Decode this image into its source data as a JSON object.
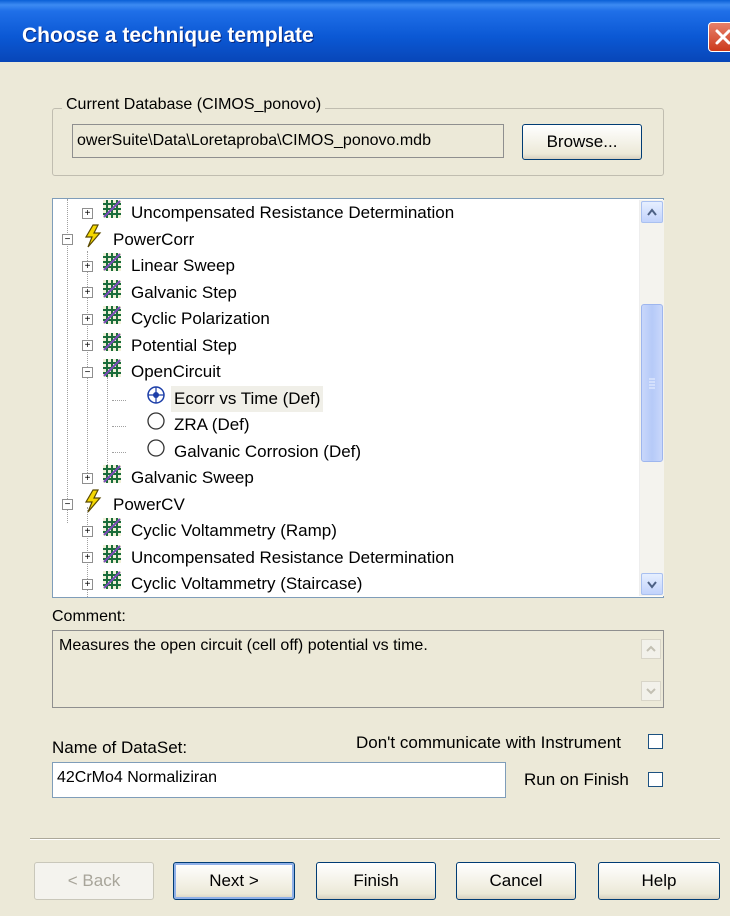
{
  "window": {
    "title": "Choose a technique template"
  },
  "database": {
    "group_label": "Current Database (CIMOS_ponovo)",
    "path": "owerSuite\\Data\\Loretaproba\\CIMOS_ponovo.mdb",
    "browse_label": "Browse..."
  },
  "tree": {
    "items": [
      {
        "label": "Uncompensated Resistance Determination",
        "icon": "grid-icon",
        "expander": "+"
      },
      {
        "label": "PowerCorr",
        "icon": "lightning-icon",
        "expander": "-"
      },
      {
        "label": "Linear Sweep",
        "icon": "grid-icon",
        "expander": "+"
      },
      {
        "label": "Galvanic Step",
        "icon": "grid-icon",
        "expander": "+"
      },
      {
        "label": "Cyclic Polarization",
        "icon": "grid-icon",
        "expander": "+"
      },
      {
        "label": "Potential Step",
        "icon": "grid-icon",
        "expander": "+"
      },
      {
        "label": "OpenCircuit",
        "icon": "grid-icon",
        "expander": "-"
      },
      {
        "label": "Ecorr vs Time (Def)",
        "icon": "radio-selected-icon",
        "selected": true
      },
      {
        "label": "ZRA (Def)",
        "icon": "radio-icon"
      },
      {
        "label": "Galvanic Corrosion (Def)",
        "icon": "radio-icon"
      },
      {
        "label": "Galvanic Sweep",
        "icon": "grid-icon",
        "expander": "+"
      },
      {
        "label": "PowerCV",
        "icon": "lightning-icon",
        "expander": "-"
      },
      {
        "label": "Cyclic Voltammetry (Ramp)",
        "icon": "grid-icon",
        "expander": "+"
      },
      {
        "label": "Uncompensated Resistance Determination",
        "icon": "grid-icon",
        "expander": "+"
      },
      {
        "label": "Cyclic Voltammetry (Staircase)",
        "icon": "grid-icon",
        "expander": "+"
      }
    ]
  },
  "comment": {
    "label": "Comment:",
    "text": "Measures the open circuit (cell off) potential vs time."
  },
  "options": {
    "no_comm_label": "Don't communicate with Instrument",
    "no_comm_checked": false,
    "run_on_finish_label": "Run on Finish",
    "run_on_finish_checked": false
  },
  "dataset": {
    "label": "Name of DataSet:",
    "value": "42CrMo4 Normaliziran"
  },
  "buttons": {
    "back": "< Back",
    "next": "Next >",
    "finish": "Finish",
    "cancel": "Cancel",
    "help": "Help"
  },
  "colors": {
    "title_bar": "#0b58d4",
    "dialog_bg": "#ece9d8",
    "grid_icon": "#1a6d3a",
    "lightning_icon": "#f5d800"
  }
}
